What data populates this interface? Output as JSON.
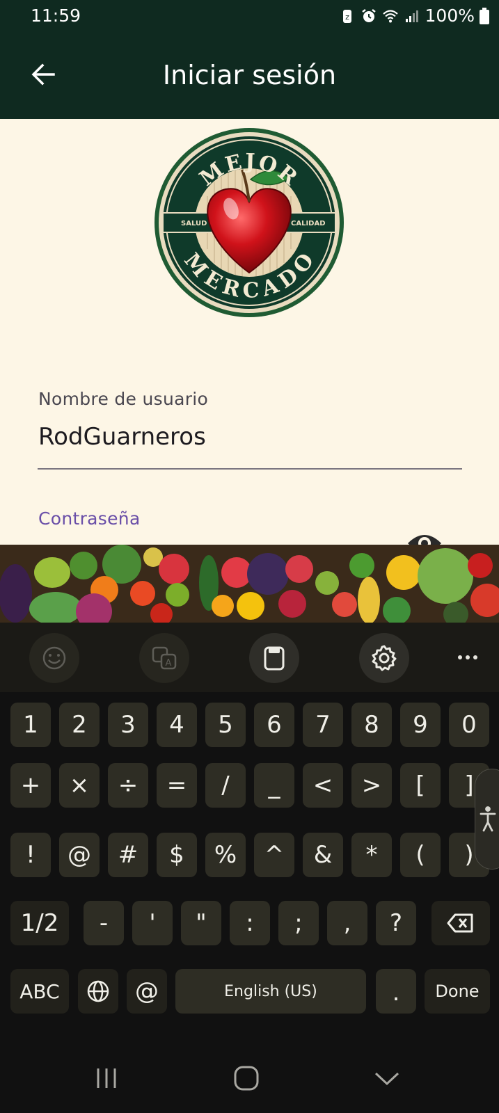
{
  "status_bar": {
    "time": "11:59",
    "battery": "100%",
    "icons": [
      "battery-saver-icon",
      "alarm-icon",
      "wifi-icon",
      "signal-icon",
      "battery-icon"
    ]
  },
  "app_bar": {
    "title": "Iniciar sesión",
    "back_icon": "arrow-left-icon"
  },
  "logo": {
    "top_text": "MEJOR",
    "bottom_text": "MERCADO",
    "left_text": "SALUD",
    "right_text": "CALIDAD"
  },
  "form": {
    "username_label": "Nombre de usuario",
    "username_value": "RodGuarneros",
    "password_label": "Contraseña",
    "password_toggle_icon": "eye-icon"
  },
  "keyboard": {
    "toolbar": [
      "emoji-icon",
      "translate-icon",
      "clipboard-icon",
      "settings-icon",
      "more-icon"
    ],
    "row1": [
      "1",
      "2",
      "3",
      "4",
      "5",
      "6",
      "7",
      "8",
      "9",
      "0"
    ],
    "row2": [
      "+",
      "×",
      "÷",
      "=",
      "/",
      "_",
      "<",
      ">",
      "[",
      "]"
    ],
    "row3": [
      "!",
      "@",
      "#",
      "$",
      "%",
      "^",
      "&",
      "*",
      "(",
      ")"
    ],
    "row4": {
      "page": "1/2",
      "keys": [
        "-",
        "'",
        "\"",
        ":",
        ";",
        ",",
        "?"
      ],
      "backspace_icon": "backspace-icon"
    },
    "row5": {
      "abc": "ABC",
      "globe_icon": "globe-icon",
      "at": "@",
      "space": "English (US)",
      "period": ".",
      "done": "Done"
    }
  },
  "nav_bar": [
    "recents-icon",
    "home-icon",
    "back-chevron-icon"
  ],
  "colors": {
    "app_bar": "#0f2a20",
    "background": "#fdf6e6",
    "accent": "#6a4fa8",
    "keyboard_key": "#2e2d24"
  }
}
